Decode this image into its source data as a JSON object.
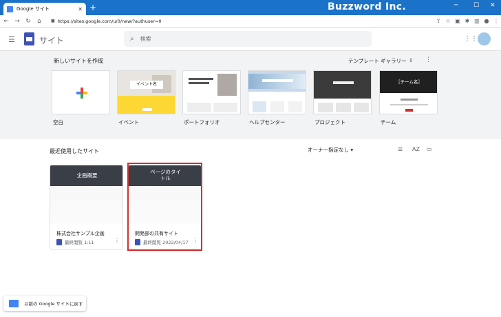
{
  "browser": {
    "tab_title": "Google サイト",
    "tab_close": "✕",
    "new_tab": "+",
    "url": "https://sites.google.com/u/0/new/?authuser=0",
    "brand_watermark": "Buzzword Inc."
  },
  "header": {
    "app_title": "サイト",
    "search_placeholder": "検索"
  },
  "templates": {
    "section_title": "新しいサイトを作成",
    "gallery_label": "テンプレート ギャラリー",
    "items": [
      {
        "label": "空白",
        "hero_text": ""
      },
      {
        "label": "イベント",
        "hero_text": "イベント名"
      },
      {
        "label": "ポートフォリオ",
        "hero_text": ""
      },
      {
        "label": "ヘルプセンター",
        "hero_text": ""
      },
      {
        "label": "プロジェクト",
        "hero_text": ""
      },
      {
        "label": "チーム",
        "hero_text": "［チーム名］"
      }
    ]
  },
  "recent": {
    "section_title": "最近使用したサイト",
    "owner_filter": "オーナー指定なし",
    "sites": [
      {
        "hero_text": "企画概要",
        "name": "株式会社サンプル企画",
        "meta": "最終閲覧 1:11"
      },
      {
        "hero_text": "ページのタイトル",
        "name": "開発部の共有サイト",
        "meta": "最終閲覧 2022/04/17"
      }
    ]
  },
  "footer": {
    "legacy_link": "以前の Google サイトに戻す"
  },
  "colors": {
    "tabbar": "#1a73c8",
    "accent": "#3f51b5",
    "selection": "#d32f2f"
  }
}
